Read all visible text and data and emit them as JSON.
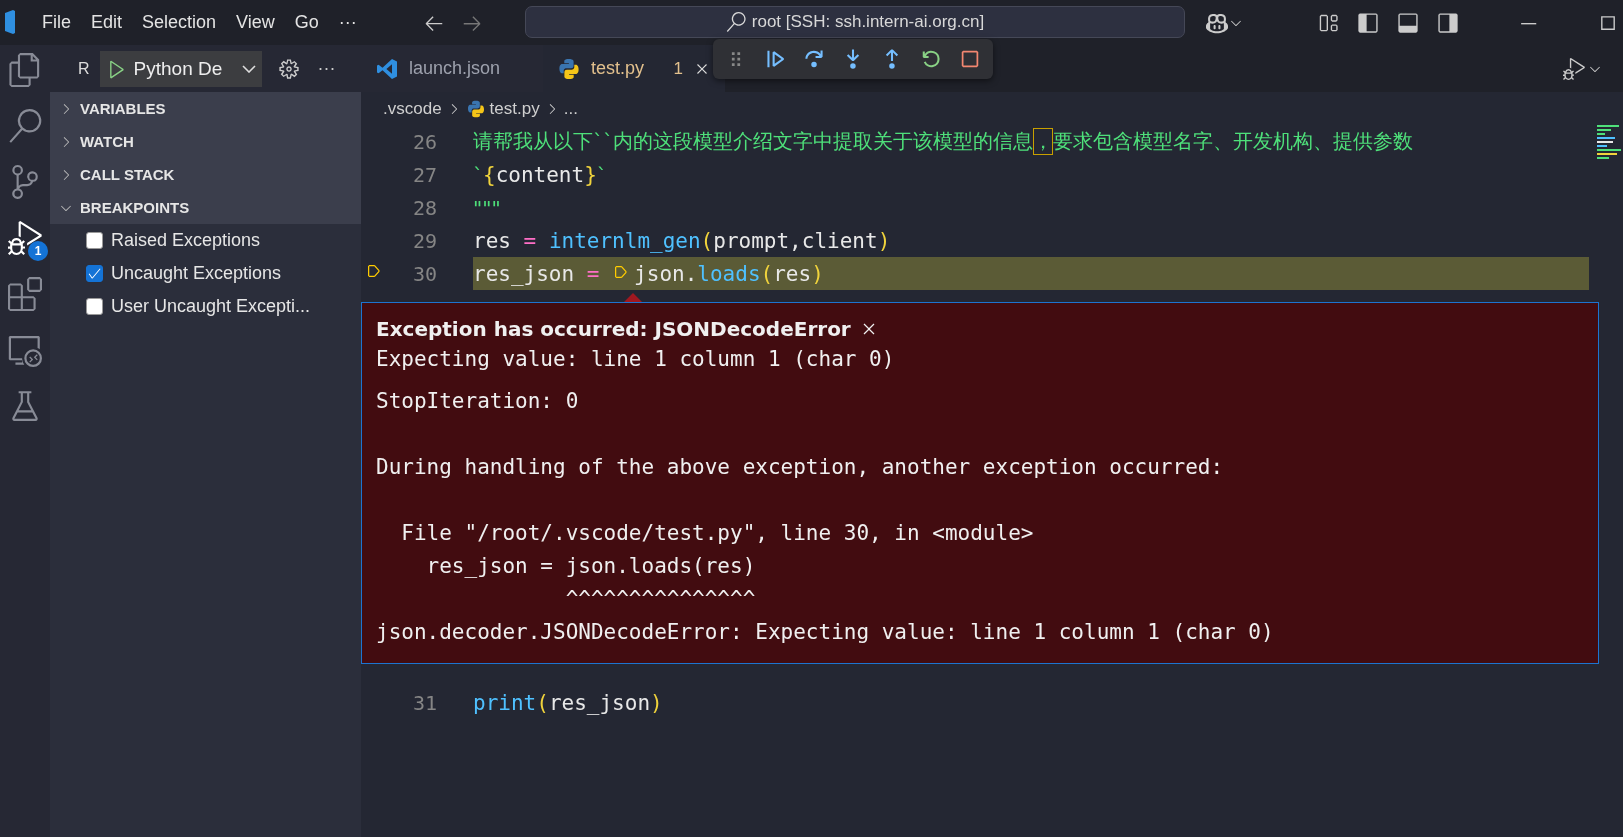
{
  "title_bar": {
    "menu": [
      {
        "label": "File"
      },
      {
        "label": "Edit"
      },
      {
        "label": "Selection"
      },
      {
        "label": "View"
      },
      {
        "label": "Go"
      }
    ],
    "more": "···",
    "command_center": "root [SSH: ssh.intern-ai.org.cn]"
  },
  "activity_bar": [
    {
      "kind": "explorer",
      "selected": false
    },
    {
      "kind": "search",
      "selected": false
    },
    {
      "kind": "source_control",
      "selected": false
    },
    {
      "kind": "debug",
      "selected": true,
      "badge": "1"
    },
    {
      "kind": "extensions",
      "selected": false
    },
    {
      "kind": "remote",
      "selected": false
    },
    {
      "kind": "testing",
      "selected": false
    }
  ],
  "sidebar": {
    "title": "R",
    "config": "Python De",
    "more": "···",
    "sections": [
      {
        "label": "VARIABLES",
        "expanded": false
      },
      {
        "label": "WATCH",
        "expanded": false
      },
      {
        "label": "CALL STACK",
        "expanded": false
      },
      {
        "label": "BREAKPOINTS",
        "expanded": true
      }
    ],
    "breakpoints": [
      {
        "label": "Raised Exceptions",
        "checked": false
      },
      {
        "label": "Uncaught Exceptions",
        "checked": true
      },
      {
        "label": "User Uncaught Excepti...",
        "checked": false
      }
    ]
  },
  "tabs": [
    {
      "label": "launch.json",
      "kind": "vscode",
      "selected": false
    },
    {
      "label": "test.py",
      "kind": "python",
      "selected": true,
      "problems": "1"
    }
  ],
  "breadcrumb": [
    {
      "label": ".vscode",
      "kind": "folder"
    },
    {
      "label": "test.py",
      "kind": "python"
    },
    {
      "label": "...",
      "kind": "symbol"
    }
  ],
  "code_lines": [
    {
      "number": "26",
      "current": false,
      "tokens": [
        {
          "kind": "str",
          "text": "请帮我从以下``内的这段模型介绍文字中提取关于该模型的信息"
        },
        {
          "kind": "flag",
          "text": "，"
        },
        {
          "kind": "str",
          "text": "要求包含模型名字、开发机构、提供参数"
        }
      ]
    },
    {
      "number": "27",
      "current": false,
      "tokens": [
        {
          "kind": "str",
          "text": "`"
        },
        {
          "kind": "brace",
          "text": "{"
        },
        {
          "kind": "name",
          "text": "content"
        },
        {
          "kind": "brace",
          "text": "}"
        },
        {
          "kind": "str",
          "text": "`"
        }
      ]
    },
    {
      "number": "28",
      "current": false,
      "tokens": [
        {
          "kind": "str",
          "text": "\"\"\""
        }
      ]
    },
    {
      "number": "29",
      "current": false,
      "tokens": [
        {
          "kind": "name",
          "text": "res "
        },
        {
          "kind": "op",
          "text": "= "
        },
        {
          "kind": "func",
          "text": "internlm_gen"
        },
        {
          "kind": "brace",
          "text": "("
        },
        {
          "kind": "name",
          "text": "prompt,client"
        },
        {
          "kind": "brace",
          "text": ")"
        }
      ]
    },
    {
      "number": "30",
      "current": true,
      "tokens": [
        {
          "kind": "name",
          "text": "res_json "
        },
        {
          "kind": "op",
          "text": "= "
        },
        {
          "kind": "stop_marker"
        },
        {
          "kind": "name",
          "text": "json."
        },
        {
          "kind": "func",
          "text": "loads"
        },
        {
          "kind": "brace",
          "text": "("
        },
        {
          "kind": "name",
          "text": "res"
        },
        {
          "kind": "brace",
          "text": ")"
        }
      ],
      "exception": {
        "title": "Exception has occurred: JSONDecodeError",
        "message": "Expecting value: line 1 column 1 (char 0)",
        "details": "StopIteration: 0\n\nDuring handling of the above exception, another exception occurred:\n\n  File \"/root/.vscode/test.py\", line 30, in <module>\n    res_json = json.loads(res)\n               ^^^^^^^^^^^^^^^\njson.decoder.JSONDecodeError: Expecting value: line 1 column 1 (char 0)"
      }
    },
    {
      "number": "31",
      "current": false,
      "tokens": [
        {
          "kind": "func",
          "text": "print"
        },
        {
          "kind": "brace",
          "text": "("
        },
        {
          "kind": "name",
          "text": "res_json"
        },
        {
          "kind": "brace",
          "text": ")"
        }
      ]
    }
  ]
}
